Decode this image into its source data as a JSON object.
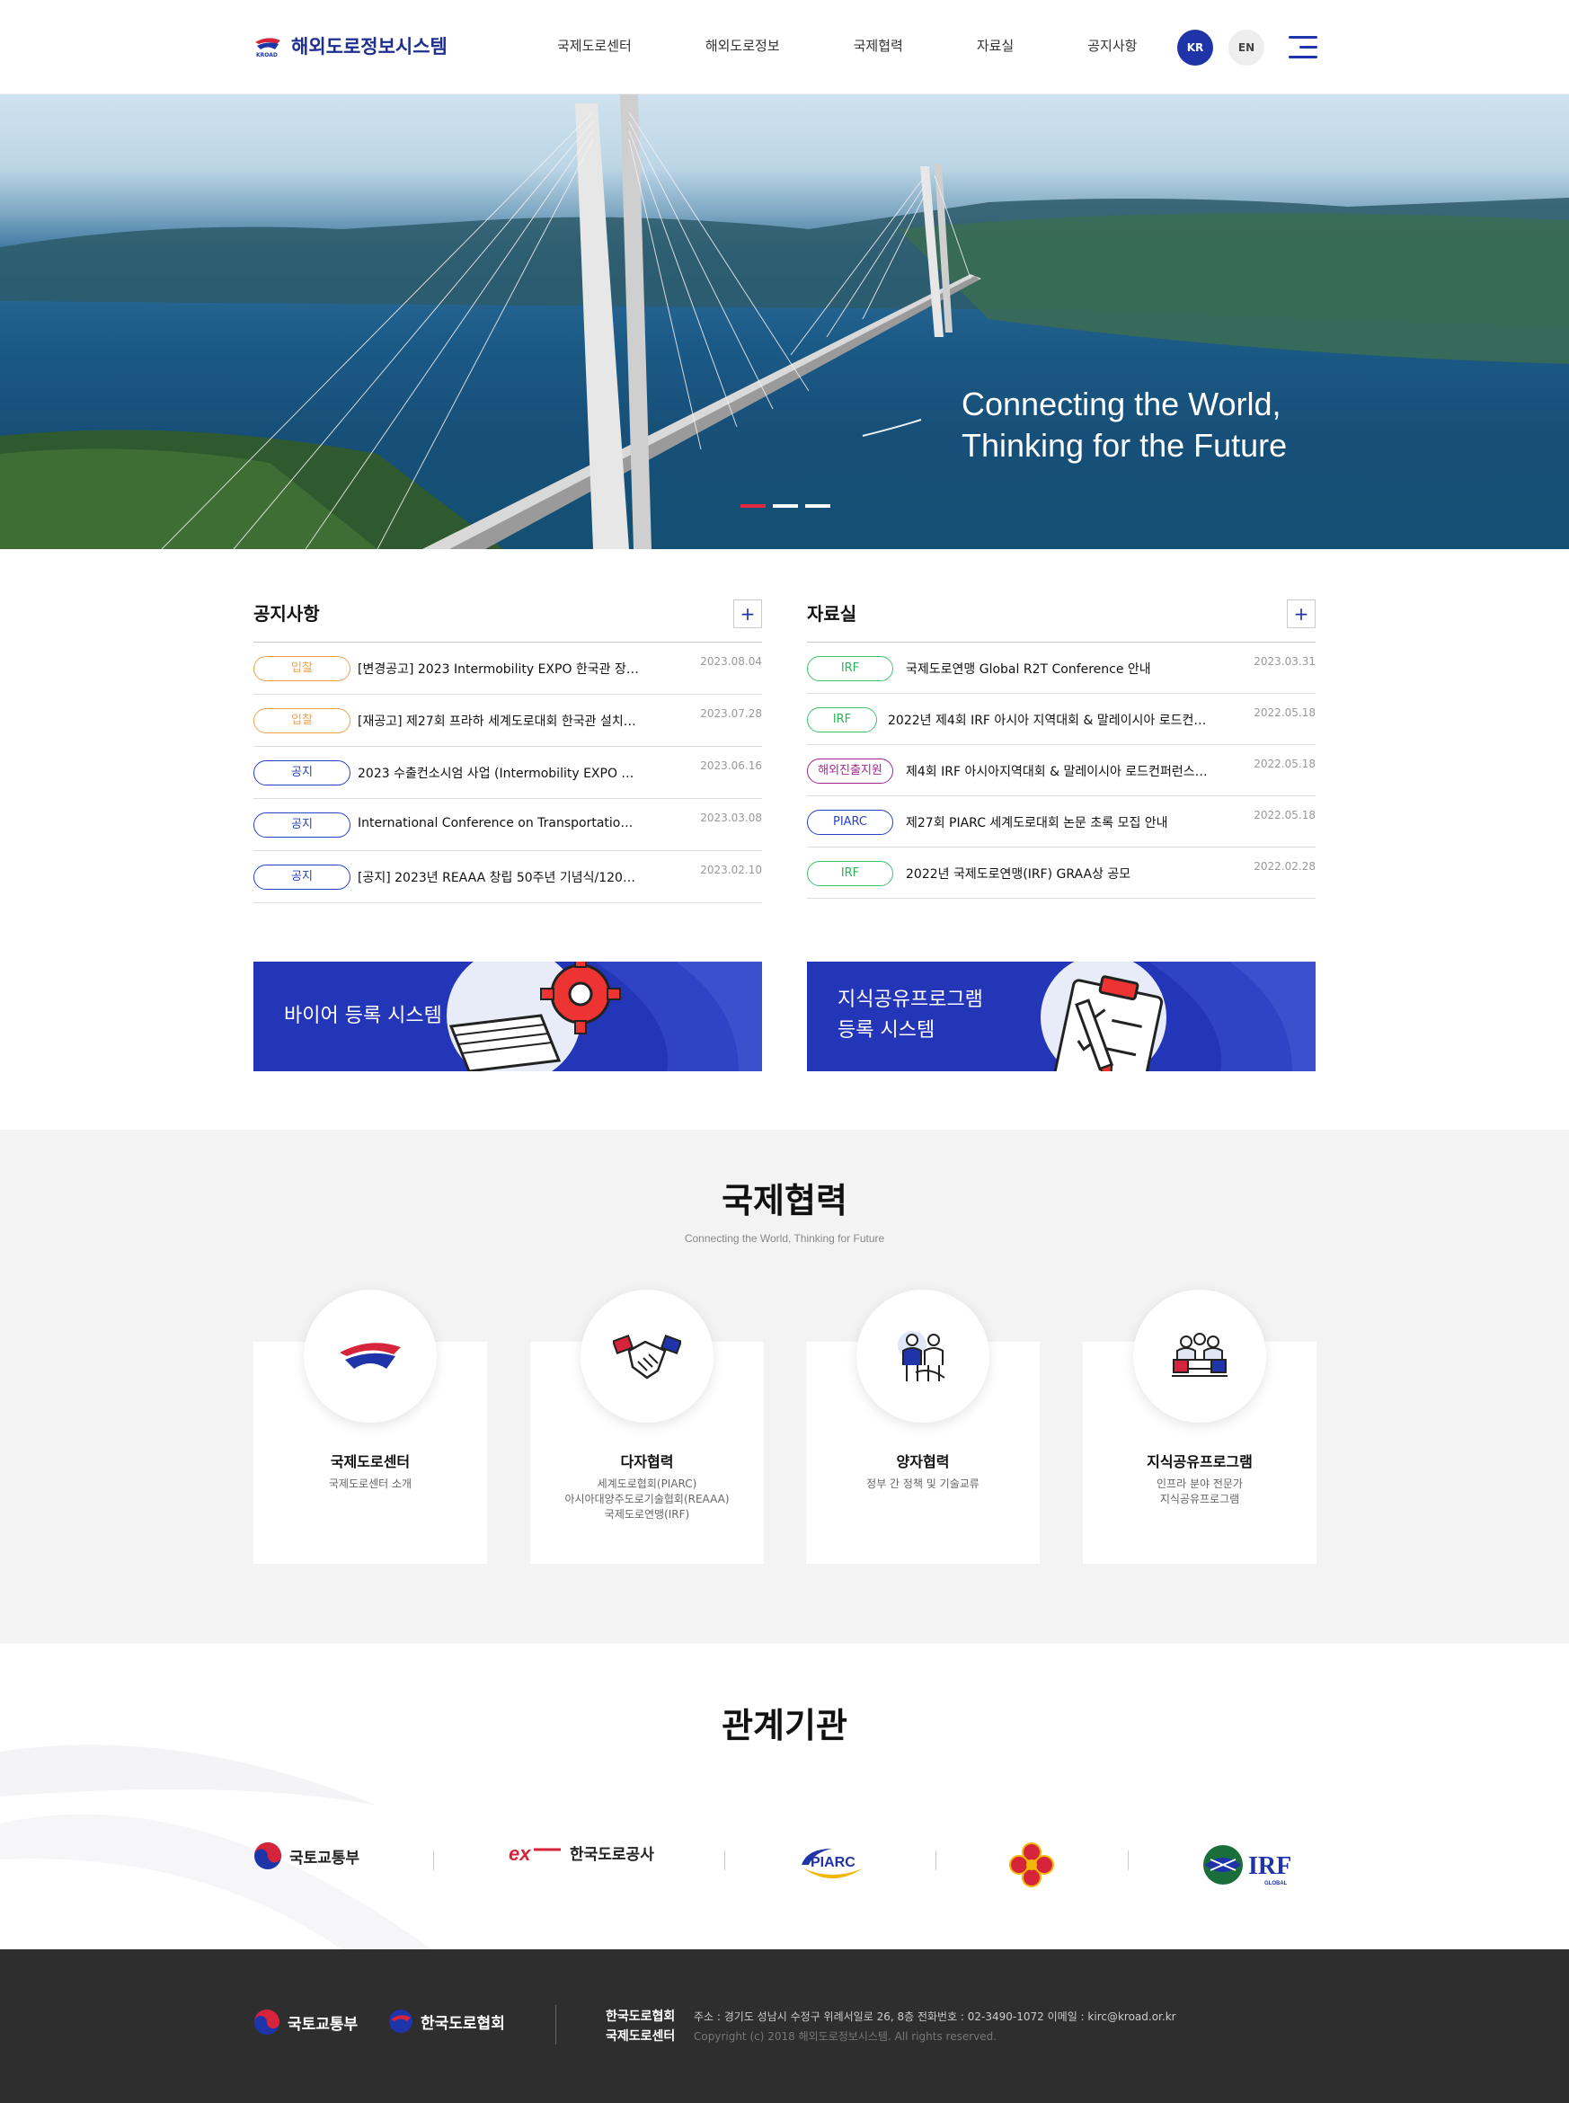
{
  "header": {
    "logo_text": "해외도로정보시스템",
    "logo_mark_text": "KROAD",
    "nav": [
      "국제도로센터",
      "해외도로정보",
      "국제협력",
      "자료실",
      "공지사항"
    ],
    "lang_kr": "KR",
    "lang_en": "EN"
  },
  "hero": {
    "line1": "Connecting the World,",
    "line2": "Thinking for the Future",
    "active_slide": 1,
    "slide_count": 3
  },
  "notice": {
    "title": "공지사항",
    "more": "+",
    "items": [
      {
        "tag": "입찰",
        "text": "[변경공고] 2023 Intermobility EXPO 한국관 장…",
        "date": "2023.08.04"
      },
      {
        "tag": "입찰",
        "text": "[재공고] 제27회 프라하 세계도로대회 한국관 설치…",
        "date": "2023.07.28"
      },
      {
        "tag": "공지",
        "text": "2023 수출컨소시엄 사업 (Intermobility EXPO …",
        "date": "2023.06.16"
      },
      {
        "tag": "공지",
        "text": "International Conference on Transportatio…",
        "date": "2023.03.08"
      },
      {
        "tag": "공지",
        "text": "[공지] 2023년 REAAA 창립 50주년 기념식/120…",
        "date": "2023.02.10"
      }
    ]
  },
  "archive": {
    "title": "자료실",
    "more": "+",
    "items": [
      {
        "tag": "IRF",
        "text": "국제도로연맹 Global R2T Conference 안내",
        "date": "2023.03.31"
      },
      {
        "tag": "IRF",
        "text": "2022년 제4회 IRF 아시아 지역대회 & 말레이시아 로드컨…",
        "date": "2022.05.18"
      },
      {
        "tag": "해외진출지원",
        "text": "제4회 IRF 아시아지역대회 & 말레이시아 로드컨퍼런스 및…",
        "date": "2022.05.18"
      },
      {
        "tag": "PIARC",
        "text": "제27회 PIARC 세계도로대회 논문 초록 모집 안내",
        "date": "2022.05.18"
      },
      {
        "tag": "IRF",
        "text": "2022년 국제도로연맹(IRF) GRAA상 공모",
        "date": "2022.02.28"
      }
    ]
  },
  "banners": {
    "buyer_line1": "바이어 등록 시스템",
    "ksp_line1": "지식공유프로그램",
    "ksp_line2": "등록 시스템"
  },
  "coop": {
    "title": "국제협력",
    "subtitle": "Connecting the World, Thinking for Future",
    "cards": [
      {
        "title": "국제도로센터",
        "desc": [
          "국제도로센터 소개"
        ]
      },
      {
        "title": "다자협력",
        "desc": [
          "세계도로협회(PIARC)",
          "아시아대양주도로기술협회(REAAA)",
          "국제도로연맹(IRF)"
        ]
      },
      {
        "title": "양자협력",
        "desc": [
          "정부 간 정책 및 기술교류"
        ]
      },
      {
        "title": "지식공유프로그램",
        "desc": [
          "인프라 분야 전문가",
          "지식공유프로그램"
        ]
      }
    ]
  },
  "related": {
    "title": "관계기관",
    "orgs": [
      "국토교통부",
      "한국도로공사",
      "PIARC",
      "IRF",
      "GLOBAL"
    ]
  },
  "footer": {
    "logo1": "국토교통부",
    "logo2": "한국도로협회",
    "org1": "한국도로협회",
    "org2": "국제도로센터",
    "address": "주소 : 경기도 성남시 수정구 위례서일로 26, 8층 전화번호 : 02-3490-1072 이메일 : kirc@kroad.or.kr",
    "copyright": "Copyright (c) 2018 해외도로정보시스템. All rights reserved."
  },
  "colors": {
    "brand_blue": "#1e34a8",
    "banner_blue": "#2436b8",
    "accent_red": "#e4283d",
    "tag_orange": "#f2a24a",
    "tag_green": "#2bb35a",
    "tag_purple": "#a1288f"
  }
}
